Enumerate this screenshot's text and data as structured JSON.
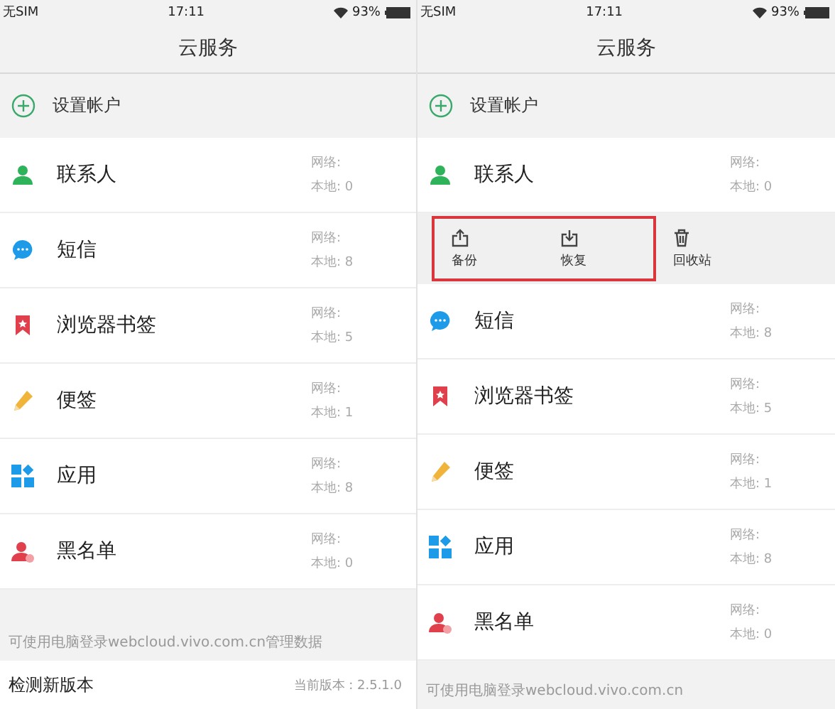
{
  "screens": [
    {
      "status_bar": {
        "carrier": "无SIM",
        "time": "17:11",
        "battery": "93%"
      },
      "title": "云服务",
      "account_row": {
        "label": "设置帐户"
      },
      "items": [
        {
          "kind": "contacts",
          "name": "联系人",
          "network": "网络:",
          "local": "本地: 0"
        },
        {
          "kind": "sms",
          "name": "短信",
          "network": "网络:",
          "local": "本地: 8"
        },
        {
          "kind": "bookmark",
          "name": "浏览器书签",
          "network": "网络:",
          "local": "本地: 5"
        },
        {
          "kind": "note",
          "name": "便签",
          "network": "网络:",
          "local": "本地: 1"
        },
        {
          "kind": "apps",
          "name": "应用",
          "network": "网络:",
          "local": "本地: 8"
        },
        {
          "kind": "blacklist",
          "name": "黑名单",
          "network": "网络:",
          "local": "本地: 0"
        }
      ],
      "footer_note": "可使用电脑登录webcloud.vivo.com.cn管理数据",
      "version_row": {
        "label": "检测新版本",
        "value": "当前版本 : 2.5.1.0"
      }
    },
    {
      "status_bar": {
        "carrier": "无SIM",
        "time": "17:11",
        "battery": "93%"
      },
      "title": "云服务",
      "account_row": {
        "label": "设置帐户"
      },
      "items": [
        {
          "kind": "contacts",
          "name": "联系人",
          "network": "网络:",
          "local": "本地: 0"
        },
        {
          "kind": "actions",
          "actions": [
            {
              "kind": "backup",
              "label": "备份",
              "highlighted": true
            },
            {
              "kind": "restore",
              "label": "恢复",
              "highlighted": true
            },
            {
              "kind": "trash",
              "label": "回收站",
              "highlighted": false
            }
          ]
        },
        {
          "kind": "sms",
          "name": "短信",
          "network": "网络:",
          "local": "本地: 8"
        },
        {
          "kind": "bookmark",
          "name": "浏览器书签",
          "network": "网络:",
          "local": "本地: 5"
        },
        {
          "kind": "note",
          "name": "便签",
          "network": "网络:",
          "local": "本地: 1"
        },
        {
          "kind": "apps",
          "name": "应用",
          "network": "网络:",
          "local": "本地: 8"
        },
        {
          "kind": "blacklist",
          "name": "黑名单",
          "network": "网络:",
          "local": "本地: 0"
        }
      ],
      "footer_note": "可使用电脑登录webcloud.vivo.com.cn"
    }
  ]
}
